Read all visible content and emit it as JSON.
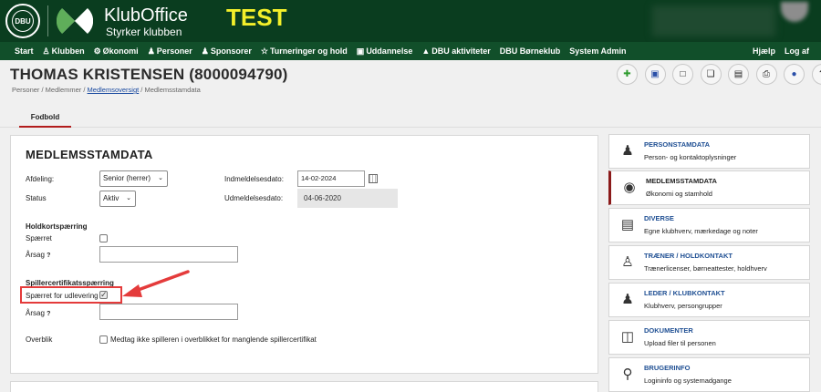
{
  "header": {
    "dbu_logo_text": "DBU",
    "brand_name": "KlubOffice",
    "brand_tagline": "Styrker klubben",
    "environment_label": "TEST"
  },
  "nav": {
    "items": [
      {
        "label": "Start",
        "icon": ""
      },
      {
        "label": "Klubben",
        "icon": "people-icon"
      },
      {
        "label": "Økonomi",
        "icon": "currency-icon"
      },
      {
        "label": "Personer",
        "icon": "person-icon"
      },
      {
        "label": "Sponsorer",
        "icon": "person-icon"
      },
      {
        "label": "Turneringer og hold",
        "icon": "trophy-icon"
      },
      {
        "label": "Uddannelse",
        "icon": "board-icon"
      },
      {
        "label": "DBU aktiviteter",
        "icon": "graduation-icon"
      },
      {
        "label": "DBU Børneklub",
        "icon": ""
      },
      {
        "label": "System Admin",
        "icon": ""
      }
    ],
    "help": "Hjælp",
    "logout": "Log af"
  },
  "page": {
    "title": "THOMAS KRISTENSEN (8000094790)",
    "breadcrumb": {
      "part1": "Personer / Medlemmer / ",
      "link": "Medlemsoversigt",
      "part2": " / Medlemsstamdata"
    }
  },
  "toolbar": {
    "buttons": [
      "add-icon",
      "save-icon",
      "document-icon",
      "copy-icon",
      "file-icon",
      "print-icon",
      "info-icon",
      "help-icon"
    ],
    "help_label": "?"
  },
  "tabs": {
    "active": "Fodbold"
  },
  "form": {
    "section_title": "MEDLEMSSTAMDATA",
    "afdeling_label": "Afdeling:",
    "afdeling_value": "Senior (herrer)",
    "status_label": "Status",
    "status_value": "Aktiv",
    "indmeldelse_label": "Indmeldelsesdato:",
    "indmeldelse_value": "14-02-2024",
    "udmeldelse_label": "Udmeldelsesdato:",
    "udmeldelse_value": "04-06-2020",
    "holdkort_title": "Holdkortspærring",
    "holdkort_spaerret_label": "Spærret",
    "holdkort_spaerret_checked": false,
    "holdkort_aarsag_label": "Årsag",
    "holdkort_aarsag_value": "",
    "spillercert_title": "Spillercertifikatsspærring",
    "spillercert_spaerret_label": "Spærret for udlevering",
    "spillercert_spaerret_checked": true,
    "spillercert_aarsag_label": "Årsag",
    "spillercert_aarsag_value": "",
    "overblik_label": "Overblik",
    "overblik_checkbox_label": "Medtag ikke spilleren i overblikket for manglende spillercertifikat",
    "overblik_checked": false,
    "help_marker": "?"
  },
  "sidebar": {
    "items": [
      {
        "title": "PERSONSTAMDATA",
        "subtitle": "Person- og kontaktoplysninger",
        "icon": "person-icon",
        "active": false
      },
      {
        "title": "MEDLEMSSTAMDATA",
        "subtitle": "Økonomi og stamhold",
        "icon": "piggy-bank-icon",
        "active": true
      },
      {
        "title": "DIVERSE",
        "subtitle": "Egne klubhverv, mærkedage og noter",
        "icon": "archive-box-icon",
        "active": false
      },
      {
        "title": "TRÆNER / HOLDKONTAKT",
        "subtitle": "Trænerlicenser, børneattester, holdhverv",
        "icon": "coach-icon",
        "active": false
      },
      {
        "title": "LEDER / KLUBKONTAKT",
        "subtitle": "Klubhverv, persongrupper",
        "icon": "leader-icon",
        "active": false
      },
      {
        "title": "DOKUMENTER",
        "subtitle": "Upload filer til personen",
        "icon": "binders-icon",
        "active": false
      },
      {
        "title": "BRUGERINFO",
        "subtitle": "Logininfo og systemadgange",
        "icon": "key-icon",
        "active": false
      }
    ]
  },
  "colors": {
    "header_bg": "#0a3d1f",
    "nav_bg": "#114f2a",
    "test_label": "#f3ef2a",
    "active_tab_underline": "#b21c1c",
    "sidebar_title": "#1f4f93",
    "annotation_red": "#e43b3b"
  }
}
